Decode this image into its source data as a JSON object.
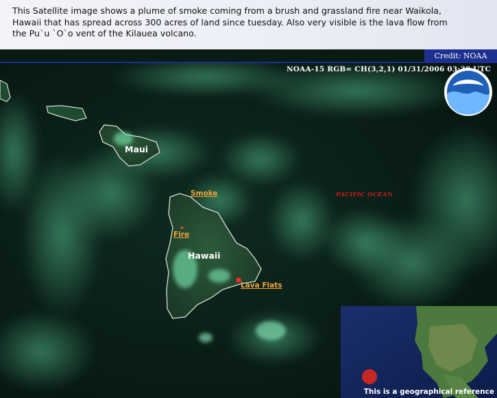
{
  "caption": {
    "text": "This Satellite image shows a plume of smoke coming from a brush and grassland fire near Waikola, Hawaii that has spread across 300 acres of land since tuesday. Also very visible is the lava flow from the Pu`u `O`o vent of the Kilauea volcano."
  },
  "credit": "Credit: NOAA",
  "satellite_header": "NOAA-15  RGB= CH(3,2,1) 01/31/2006 03:30 UTC",
  "logo": {
    "text": "NOAA",
    "icon": "noaa-logo-icon"
  },
  "map_labels": {
    "maui": "Maui",
    "hawaii": "Hawaii",
    "smoke": "Smoke",
    "fire": "Fire",
    "lava_flats": "Lava Flats",
    "ocean": "PACIFIC   OCEAN"
  },
  "inset": {
    "caption": "This is a geographical reference",
    "marker_color": "#c62828"
  },
  "colors": {
    "ocean": "#0a1a14",
    "cloud": "#4fbf8c",
    "label_orange": "#f2a33a",
    "ocean_label_red": "#d11a1a",
    "credit_bar": "#1d2f8f"
  }
}
